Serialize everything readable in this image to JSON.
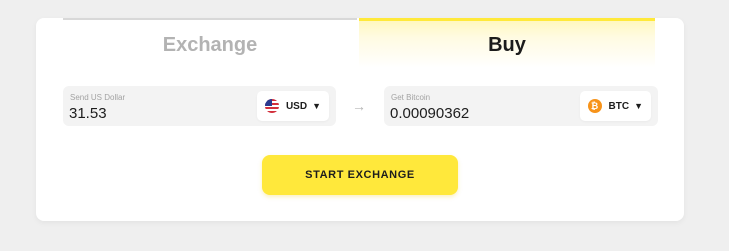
{
  "tabs": {
    "exchange": "Exchange",
    "buy": "Buy"
  },
  "send": {
    "label": "Send US Dollar",
    "value": "31.53",
    "currency": "USD",
    "icon": "us-flag-icon"
  },
  "receive": {
    "label": "Get Bitcoin",
    "value": "0.00090362",
    "currency": "BTC",
    "icon": "bitcoin-icon"
  },
  "arrow_glyph": "→",
  "caret_glyph": "▼",
  "btc_glyph": "₿",
  "cta_label": "START EXCHANGE",
  "colors": {
    "accent": "#ffe83b",
    "bitcoin": "#f7931a",
    "inactive_tab": "#b3b3b3"
  }
}
